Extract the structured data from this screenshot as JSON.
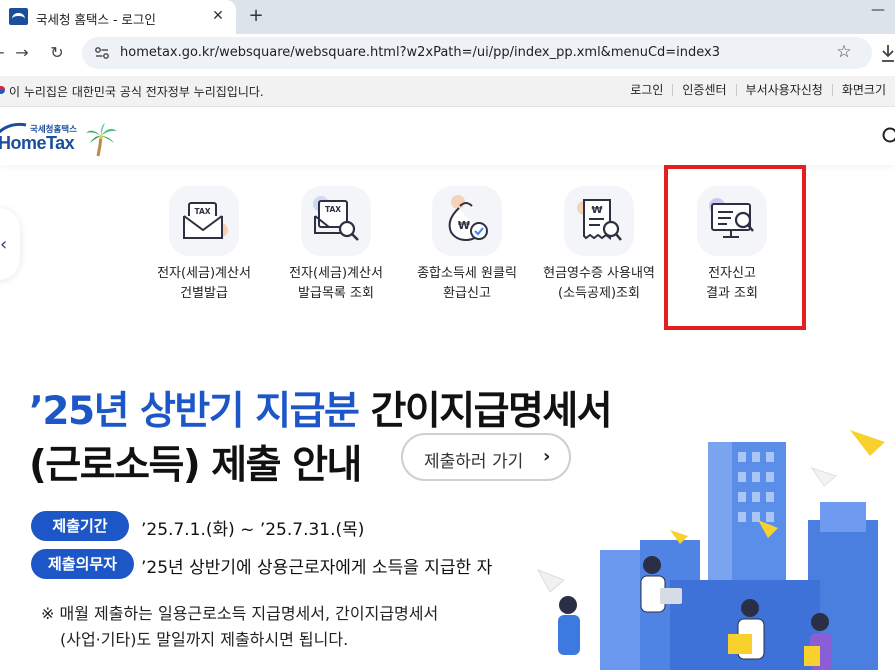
{
  "browser": {
    "tab_title": "국세청 홈택스 - 로그인",
    "tab_close_glyph": "✕",
    "new_tab_glyph": "+",
    "minimize_glyph": "—",
    "back_glyph": "←",
    "forward_glyph": "→",
    "reload_glyph": "↻",
    "url": "hometax.go.kr/websquare/websquare.html?w2xPath=/ui/pp/index_pp.xml&menuCd=index3",
    "star_glyph": "☆"
  },
  "gov_banner": {
    "text": "이 누리집은 대한민국 공식 전자정부 누리집입니다.",
    "links": [
      "로그인",
      "인증센터",
      "부서사용자신청",
      "화면크기"
    ]
  },
  "header": {
    "logo_small": "국세청홈택스",
    "logo_main": "HomeTax"
  },
  "quick_menu": {
    "prev_glyph": "‹",
    "items": [
      {
        "line1": "전자(세금)계산서",
        "line2": "건별발급",
        "icon": "tax-envelope-icon"
      },
      {
        "line1": "전자(세금)계산서",
        "line2": "발급목록 조회",
        "icon": "tax-document-search-icon"
      },
      {
        "line1": "종합소득세 원클릭",
        "line2": "환급신고",
        "icon": "money-bag-check-icon"
      },
      {
        "line1": "현금영수증 사용내역",
        "line2": "(소득공제)조회",
        "icon": "receipt-search-icon"
      },
      {
        "line1": "전자신고",
        "line2": "결과 조회",
        "icon": "monitor-search-icon"
      }
    ],
    "highlighted_index": 4,
    "highlight_color": "#e31f1f"
  },
  "banner": {
    "headline_blue": "’25년 상반기 지급분",
    "headline_dark": "간이지급명세서",
    "headline_line2": "(근로소득) 제출 안내",
    "cta_label": "제출하러 가기",
    "cta_arrow": "›",
    "period_label": "제출기간",
    "period_text": "’25.7.1.(화) ~ ’25.7.31.(목)",
    "obligor_label": "제출의무자",
    "obligor_text": "’25년 상반기에 상용근로자에게 소득을 지급한 자",
    "note_line1": "※ 매월 제출하는 일용근로소득 지급명세서, 간이지급명세서",
    "note_line2": "(사업·기타)도 말일까지 제출하시면 됩니다.",
    "accent_color": "#1d56c6"
  }
}
